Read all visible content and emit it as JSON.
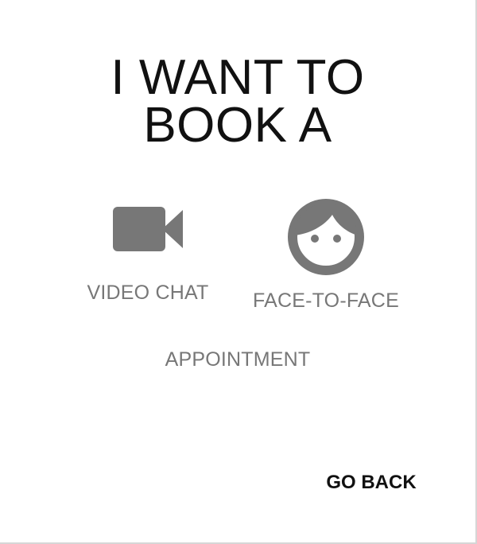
{
  "header": {
    "title_line1": "I WANT TO",
    "title_line2": "BOOK A"
  },
  "options": {
    "video_chat": {
      "label": "VIDEO CHAT",
      "icon": "video-camera-icon"
    },
    "face_to_face": {
      "label": "FACE-TO-FACE",
      "icon": "face-icon"
    }
  },
  "suffix": "APPOINTMENT",
  "actions": {
    "go_back_label": "GO BACK"
  },
  "colors": {
    "icon": "#777777",
    "option_text": "#777777",
    "title_text": "#111111",
    "background": "#ffffff"
  }
}
